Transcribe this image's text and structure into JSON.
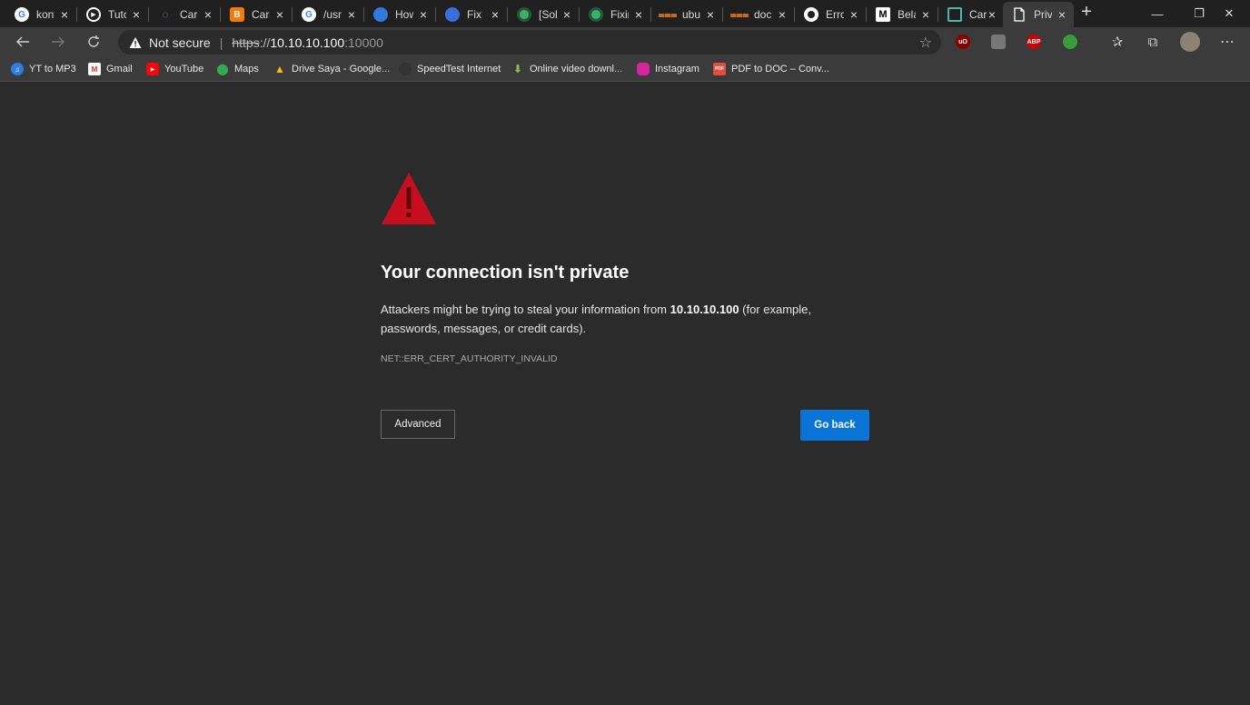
{
  "tabs": [
    {
      "title": "kont",
      "icon": "google-icon",
      "color": "#ffffff"
    },
    {
      "title": "Tuto",
      "icon": "play-icon",
      "color": "#ffffff"
    },
    {
      "title": "Cara",
      "icon": "swirl-icon",
      "color": "#9b7cf0"
    },
    {
      "title": "Cara",
      "icon": "blogger-icon",
      "color": "#f57c00"
    },
    {
      "title": "/usr",
      "icon": "google-icon",
      "color": "#ffffff"
    },
    {
      "title": "How",
      "icon": "bubble-icon",
      "color": "#2f7bd9"
    },
    {
      "title": "Fix",
      "icon": "globe-icon",
      "color": "#3a6fd8"
    },
    {
      "title": "[Sol",
      "icon": "ubuntu-icon",
      "color": "#3fae6a"
    },
    {
      "title": "Fixin",
      "icon": "ubuntu-icon",
      "color": "#3fae6a"
    },
    {
      "title": "ubu",
      "icon": "stackexchange-icon",
      "color": "#f48024"
    },
    {
      "title": "doc",
      "icon": "stackexchange-icon",
      "color": "#f48024"
    },
    {
      "title": "Erro",
      "icon": "github-icon",
      "color": "#ffffff"
    },
    {
      "title": "Bela",
      "icon": "medium-icon",
      "color": "#ffffff"
    },
    {
      "title": "Cara",
      "icon": "page-icon",
      "color": "#4db6ac"
    },
    {
      "title": "Priv",
      "icon": "document-icon",
      "color": "#ffffff"
    }
  ],
  "address": {
    "security": "Not secure",
    "scheme": "https",
    "separator": "://",
    "host": "10.10.10.100",
    "port": ":10000"
  },
  "extensions": [
    "ublock-icon",
    "extension-icon",
    "adblock-icon",
    "extension-icon"
  ],
  "bookmarks": [
    {
      "label": "YT to MP3",
      "icon": "headphones-icon"
    },
    {
      "label": "Gmail",
      "icon": "gmail-icon"
    },
    {
      "label": "YouTube",
      "icon": "youtube-icon"
    },
    {
      "label": "Maps",
      "icon": "maps-icon"
    },
    {
      "label": "Drive Saya - Google...",
      "icon": "drive-icon"
    },
    {
      "label": "SpeedTest Internet",
      "icon": "speedtest-icon"
    },
    {
      "label": "Online video downl...",
      "icon": "download-icon"
    },
    {
      "label": "Instagram",
      "icon": "instagram-icon"
    },
    {
      "label": "PDF to DOC – Conv...",
      "icon": "pdf-icon"
    }
  ],
  "page": {
    "heading": "Your connection isn't private",
    "desc_before": "Attackers might be trying to steal your information from ",
    "desc_host": "10.10.10.100",
    "desc_after": " (for example, passwords, messages, or credit cards).",
    "error_code": "NET::ERR_CERT_AUTHORITY_INVALID",
    "advanced_label": "Advanced",
    "go_back_label": "Go back"
  },
  "colors": {
    "accent": "#0a74d6",
    "warning": "#c50f1f",
    "background": "#2b2b2b"
  }
}
